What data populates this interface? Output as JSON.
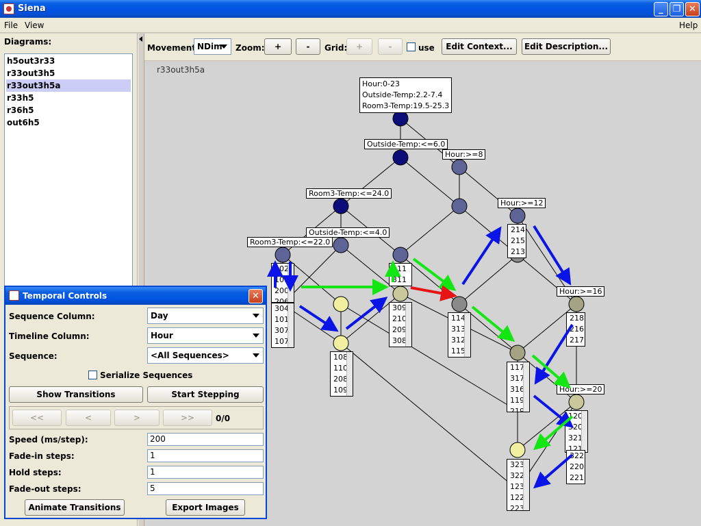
{
  "window": {
    "title": "Siena",
    "controls": [
      "_",
      "❐",
      "✕"
    ]
  },
  "menu": {
    "file": "File",
    "view": "View",
    "help": "Help"
  },
  "left": {
    "diagrams_label": "Diagrams:",
    "items": [
      "h5out3r33",
      "r33out3h5",
      "r33out3h5a",
      "r33h5",
      "r36h5",
      "out6h5"
    ],
    "selected_index": 2
  },
  "toolbar": {
    "movement_label": "Movement:",
    "movement_value": "NDim",
    "zoom_label": "Zoom:",
    "zoom_plus": "+",
    "zoom_minus": "-",
    "grid_label": "Grid:",
    "grid_plus": "+",
    "grid_minus": "-",
    "use_label": "use",
    "edit_context": "Edit Context...",
    "edit_description": "Edit Description..."
  },
  "diagram": {
    "title": "r33out3h5a",
    "top_label": [
      "Hour:0-23",
      "Outside-Temp:2.2-7.4",
      "Room3-Temp:19.5-25.3"
    ],
    "labels": {
      "outside6": "Outside-Temp:<=6.0",
      "hour8": "Hour:>=8",
      "room24": "Room3-Temp:<=24.0",
      "hour12": "Hour:>=12",
      "outside4": "Outside-Temp:<=4.0",
      "room22": "Room3-Temp:<=22.0",
      "hour16": "Hour:>=16",
      "hour20": "Hour:>=20"
    },
    "lists": {
      "l1": [
        "102",
        "101",
        "200",
        "206"
      ],
      "l2": [
        "304",
        "101",
        "307",
        "107"
      ],
      "l3": [
        "211",
        "311"
      ],
      "l4": [
        "309",
        "210",
        "209",
        "308"
      ],
      "l5": [
        "108",
        "110",
        "208",
        "109"
      ],
      "l6": [
        "214",
        "215",
        "213"
      ],
      "l7": [
        "114",
        "313",
        "312",
        "115"
      ],
      "l8": [
        "218",
        "216",
        "217"
      ],
      "l9": [
        "117",
        "317",
        "316",
        "119",
        "219"
      ],
      "l10": [
        "120",
        "320",
        "321",
        "121"
      ],
      "l11": [
        "322",
        "220",
        "221"
      ],
      "l12": [
        "323",
        "322",
        "123",
        "122",
        "223"
      ]
    },
    "colors": {
      "dark_navy": "#0d0d7a",
      "slate": "#5e6496",
      "gray": "#8a8a8a",
      "olive": "#a4a484",
      "pale_yellow": "#f0f0a0",
      "arrow_blue": "#0a14e6",
      "arrow_green": "#14e614",
      "arrow_red": "#e61414"
    }
  },
  "temporal": {
    "title": "Temporal Controls",
    "sequence_column_label": "Sequence Column:",
    "sequence_column_value": "Day",
    "timeline_column_label": "Timeline Column:",
    "timeline_column_value": "Hour",
    "sequence_label": "Sequence:",
    "sequence_value": "<All Sequences>",
    "serialize_label": "Serialize Sequences",
    "show_transitions": "Show Transitions",
    "start_stepping": "Start Stepping",
    "nav": [
      "<<",
      "<",
      ">",
      ">>"
    ],
    "counter": "0/0",
    "speed_label": "Speed (ms/step):",
    "speed_value": "200",
    "fade_in_label": "Fade-in steps:",
    "fade_in_value": "1",
    "hold_label": "Hold steps:",
    "hold_value": "1",
    "fade_out_label": "Fade-out steps:",
    "fade_out_value": "5",
    "animate": "Animate Transitions",
    "export": "Export Images"
  }
}
